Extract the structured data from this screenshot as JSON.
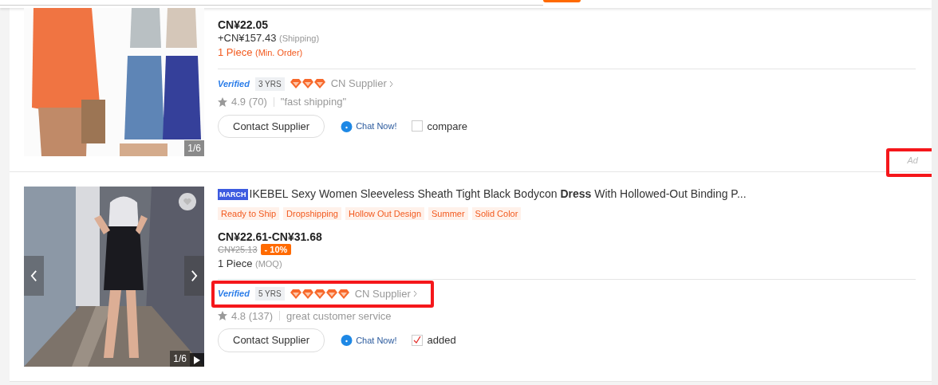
{
  "products": [
    {
      "image": {
        "counter": "1/6",
        "favorite": false,
        "arrows": false,
        "video": false
      },
      "price": "CN¥22.05",
      "shipping": "+CN¥157.43",
      "shipping_note": "(Shipping)",
      "order": {
        "kind": "min-order",
        "quantity": "1 Piece",
        "note": "(Min. Order)"
      },
      "supplier": {
        "verified": "Verified",
        "years": "3 YRS",
        "stars": 3,
        "type": "CN Supplier",
        "highlighted": false
      },
      "rating": "4.9",
      "reviews": "(70)",
      "review_tag": "\"fast shipping\"",
      "contact": "Contact Supplier",
      "chat": "Chat Now!",
      "compare": {
        "label": "compare",
        "checked": false
      },
      "ad": {
        "label": "Ad",
        "highlighted": true
      }
    },
    {
      "image": {
        "counter": "1/6",
        "favorite": true,
        "arrows": true,
        "video": true
      },
      "badge": "MARCH",
      "title": "IKEBEL Sexy Women Sleeveless Sheath Tight Black Bodycon **Dress** With Hollowed-Out Binding P...",
      "tags": [
        "Ready to Ship",
        "Dropshipping",
        "Hollow Out Design",
        "Summer",
        "Solid Color"
      ],
      "price": "CN¥22.61-CN¥31.68",
      "old_price": "CN¥25.13",
      "discount": "- 10%",
      "order": {
        "kind": "moq",
        "quantity": "1 Piece",
        "note": "(MOQ)"
      },
      "supplier": {
        "verified": "Verified",
        "years": "5 YRS",
        "stars": 5,
        "type": "CN Supplier",
        "highlighted": true
      },
      "rating": "4.8",
      "reviews": "(137)",
      "review_tag": "great customer service",
      "contact": "Contact Supplier",
      "chat": "Chat Now!",
      "compare": {
        "label": "added",
        "checked": true
      }
    }
  ]
}
